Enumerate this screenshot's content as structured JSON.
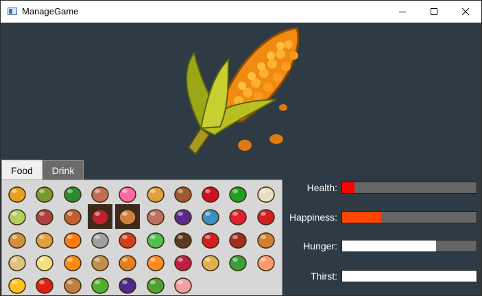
{
  "window": {
    "title": "ManageGame"
  },
  "tabs": [
    {
      "label": "Food",
      "active": true
    },
    {
      "label": "Drink",
      "active": false
    }
  ],
  "food_items": [
    "corn",
    "olives",
    "cucumber",
    "donut",
    "lollipop",
    "pizza",
    "cupcake",
    "cherries",
    "bell-pepper",
    "garlic",
    "leek",
    "steak",
    "jam-jar",
    "berries",
    "drumstick",
    "mushroom",
    "eggplant",
    "fish",
    "strawberry",
    "toadstool",
    "bread",
    "croissant",
    "carrot",
    "soup-bucket",
    "hot-dog",
    "brussels-sprout",
    "chestnut",
    "apple",
    "sausages",
    "chicken-leg",
    "sandwich",
    "fried-egg",
    "pumpkin",
    "noodle-bowl",
    "cornucopia",
    "papaya",
    "radish",
    "wheat",
    "broccoli",
    "peach",
    "cheese",
    "tomato",
    "roast-chicken",
    "peas",
    "grapes",
    "salad",
    "ham"
  ],
  "stats": [
    {
      "label": "Health:",
      "value": 0.09,
      "color": "#ff0000"
    },
    {
      "label": "Happiness:",
      "value": 0.29,
      "color": "#ff4500"
    },
    {
      "label": "Hunger:",
      "value": 0.7,
      "color": "#ffffff"
    },
    {
      "label": "Thirst:",
      "value": 1.0,
      "color": "#ffffff"
    }
  ],
  "colors": {
    "background": "#2f3b44",
    "bar_track": "#666666"
  }
}
